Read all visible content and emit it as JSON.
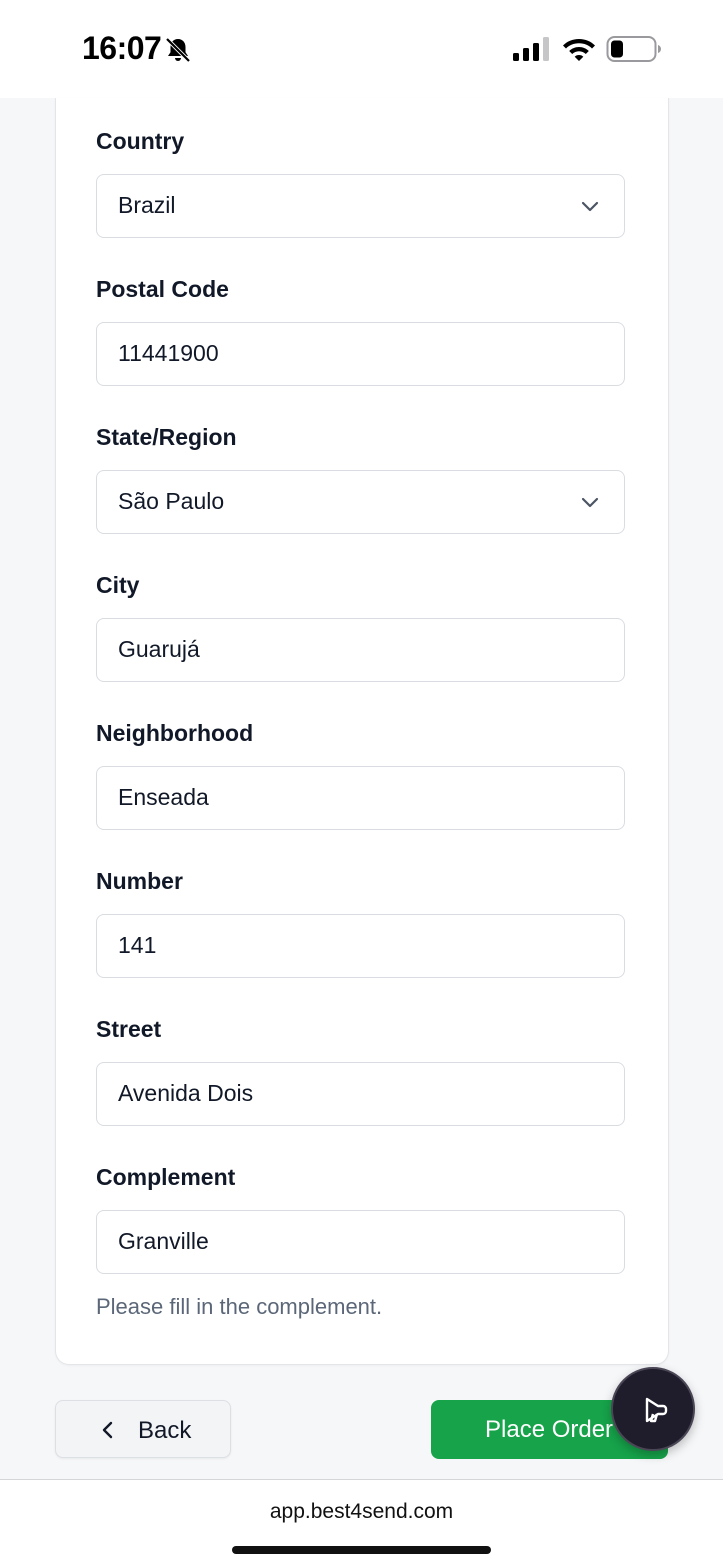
{
  "status_bar": {
    "time": "16:07",
    "icons": [
      "bell-slash-icon",
      "cellular-signal-icon",
      "wifi-icon",
      "battery-icon"
    ]
  },
  "form": {
    "fields": [
      {
        "label": "Country",
        "value": "Brazil",
        "type": "select"
      },
      {
        "label": "Postal Code",
        "value": "11441900",
        "type": "text"
      },
      {
        "label": "State/Region",
        "value": "São Paulo",
        "type": "select"
      },
      {
        "label": "City",
        "value": "Guarujá",
        "type": "text"
      },
      {
        "label": "Neighborhood",
        "value": "Enseada",
        "type": "text"
      },
      {
        "label": "Number",
        "value": "141",
        "type": "text"
      },
      {
        "label": "Street",
        "value": "Avenida Dois",
        "type": "text"
      },
      {
        "label": "Complement",
        "value": "Granville",
        "type": "text"
      }
    ],
    "complement_hint": "Please fill in the complement."
  },
  "actions": {
    "back_label": "Back",
    "place_order_label": "Place Order"
  },
  "browser": {
    "url": "app.best4send.com"
  },
  "colors": {
    "primary_green": "#16a34a",
    "fab_background": "#1f1c2c"
  }
}
